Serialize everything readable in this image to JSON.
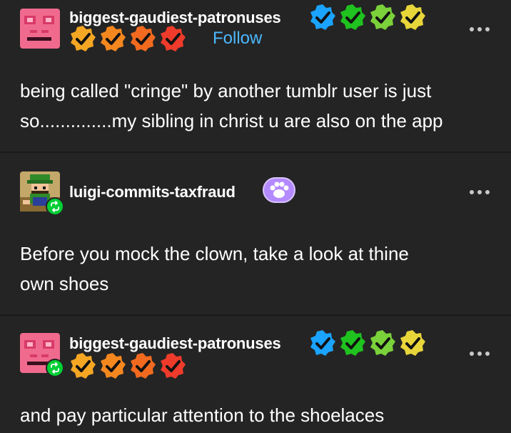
{
  "posts": [
    {
      "username": "biggest-gaudiest-patronuses",
      "follow_label": "Follow",
      "body": [
        "being called \"cringe\" by another tumblr user is just",
        "so..............my sibling in christ u are also on the app"
      ],
      "avatar_icon": "pink-face-avatar",
      "badges_row1": [
        "#1aa3ff",
        "#1fc21f",
        "#7ad13a",
        "#e8d53a"
      ],
      "badges_row2": [
        "#f5a623",
        "#f5871f",
        "#f26a1f",
        "#ee3b2b"
      ]
    },
    {
      "username": "luigi-commits-taxfraud",
      "body": [
        "Before you mock the clown, take a look at thine",
        "own shoes"
      ],
      "avatar_icon": "luigi-avatar",
      "reblog": true,
      "extra_badge": "paw-badge"
    },
    {
      "username": "biggest-gaudiest-patronuses",
      "body": [
        "and pay particular attention to the shoelaces"
      ],
      "avatar_icon": "pink-face-avatar",
      "reblog": true,
      "badges_row1": [
        "#1aa3ff",
        "#1fc21f",
        "#7ad13a",
        "#e8d53a"
      ],
      "badges_row2": [
        "#f5a623",
        "#f5871f",
        "#f26a1f",
        "#ee3b2b"
      ]
    }
  ],
  "colors": {
    "background": "#242424",
    "follow": "#4cb8ff",
    "reblog": "#01cf35"
  }
}
